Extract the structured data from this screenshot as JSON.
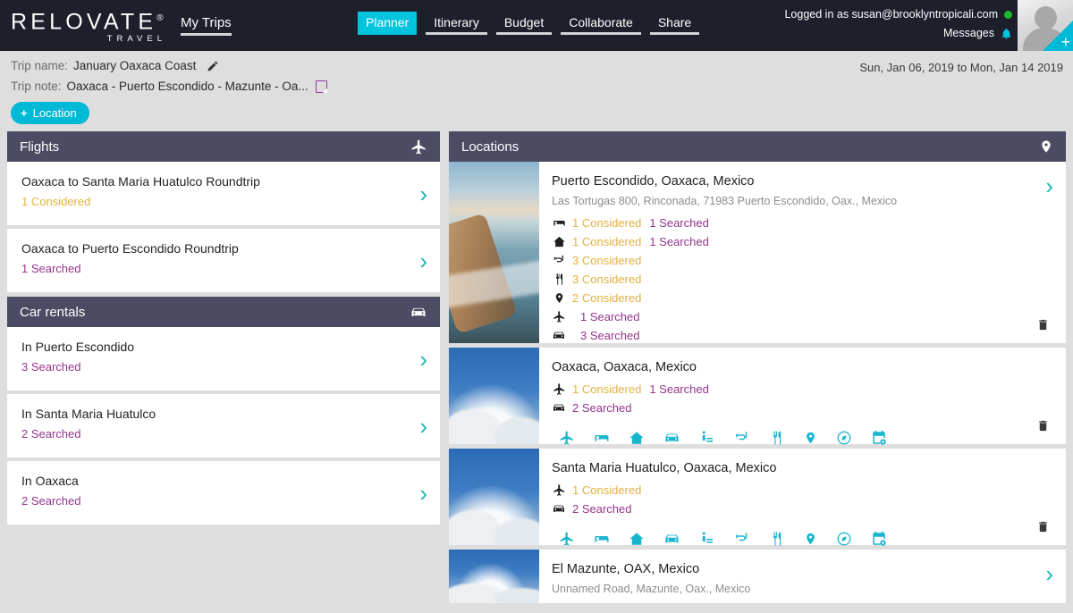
{
  "brand": {
    "name": "RELOVATE",
    "registered": "®",
    "sub": "TRAVEL"
  },
  "header": {
    "my_trips": "My Trips",
    "tabs": [
      {
        "label": "Planner",
        "active": true
      },
      {
        "label": "Itinerary",
        "active": false
      },
      {
        "label": "Budget",
        "active": false
      },
      {
        "label": "Collaborate",
        "active": false
      },
      {
        "label": "Share",
        "active": false
      }
    ],
    "logged_in": "Logged in as susan@brooklyntropicali.com",
    "messages": "Messages",
    "status_color": "#1db82b",
    "accent_color": "#00c3dd"
  },
  "trip": {
    "name_label": "Trip name:",
    "name_value": "January Oaxaca Coast",
    "note_label": "Trip note:",
    "note_value": "Oaxaca - Puerto Escondido - Mazunte - Oa...",
    "add_location": "Location",
    "add_location_plus": "+",
    "dates": "Sun, Jan 06, 2019 to Mon, Jan 14 2019"
  },
  "flights": {
    "title": "Flights",
    "icon": "plane-icon",
    "items": [
      {
        "title": "Oaxaca to Santa Maria Huatulco Roundtrip",
        "considered": "1 Considered",
        "searched": ""
      },
      {
        "title": "Oaxaca to Puerto Escondido Roundtrip",
        "considered": "",
        "searched": "1 Searched"
      }
    ]
  },
  "car_rentals": {
    "title": "Car rentals",
    "icon": "car-icon",
    "items": [
      {
        "title": "In Puerto Escondido",
        "considered": "",
        "searched": "3 Searched"
      },
      {
        "title": "In Santa Maria Huatulco",
        "considered": "",
        "searched": "2 Searched"
      },
      {
        "title": "In Oaxaca",
        "considered": "",
        "searched": "2 Searched"
      }
    ]
  },
  "locations": {
    "title": "Locations",
    "icon": "map-pin-icon",
    "action_icons": [
      "plane-icon",
      "bed-icon",
      "house-icon",
      "car-icon",
      "activity-icon",
      "snorkel-icon",
      "restaurant-icon",
      "map-pin-icon",
      "compass-icon",
      "calendar-add-icon"
    ],
    "delete_icon": "trash-icon",
    "cards": [
      {
        "name": "Puerto Escondido, Oaxaca, Mexico",
        "address": "Las Tortugas 800, Rinconada, 71983 Puerto Escondido, Oax., Mexico",
        "thumb": "beach-photo",
        "stats": [
          {
            "icon": "bed-icon",
            "considered": "1 Considered",
            "searched": "1 Searched"
          },
          {
            "icon": "house-icon",
            "considered": "1 Considered",
            "searched": "1 Searched"
          },
          {
            "icon": "snorkel-icon",
            "considered": "3 Considered",
            "searched": ""
          },
          {
            "icon": "restaurant-icon",
            "considered": "3 Considered",
            "searched": ""
          },
          {
            "icon": "map-pin-icon",
            "considered": "2 Considered",
            "searched": ""
          },
          {
            "icon": "plane-icon",
            "considered": "",
            "searched": "1 Searched"
          },
          {
            "icon": "car-icon",
            "considered": "",
            "searched": "3 Searched"
          }
        ]
      },
      {
        "name": "Oaxaca, Oaxaca, Mexico",
        "address": "",
        "thumb": "sky-photo",
        "stats": [
          {
            "icon": "plane-icon",
            "considered": "1 Considered",
            "searched": "1 Searched"
          },
          {
            "icon": "car-icon",
            "considered": "",
            "searched": "2 Searched"
          }
        ]
      },
      {
        "name": "Santa Maria Huatulco, Oaxaca, Mexico",
        "address": "",
        "thumb": "sky-photo",
        "stats": [
          {
            "icon": "plane-icon",
            "considered": "1 Considered",
            "searched": ""
          },
          {
            "icon": "car-icon",
            "considered": "",
            "searched": "2 Searched"
          }
        ]
      },
      {
        "name": "El Mazunte, OAX, Mexico",
        "address": "Unnamed Road, Mazunte, Oax., Mexico",
        "thumb": "sky-photo",
        "stats": []
      }
    ]
  },
  "colors": {
    "considered": "#e3b040",
    "searched": "#93358c",
    "panel_header": "#4b4b63",
    "chevron": "#17b9b4",
    "action_icon": "#18b6cd",
    "page_bg": "#dedede"
  }
}
